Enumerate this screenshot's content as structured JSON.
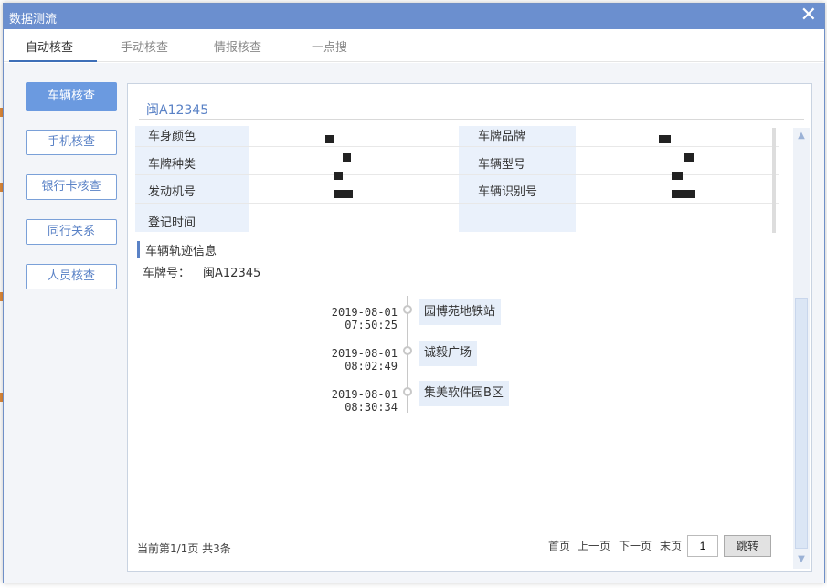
{
  "window": {
    "title": "数据测流",
    "close_glyph": "✕"
  },
  "tabs": [
    {
      "label": "自动核查",
      "active": true
    },
    {
      "label": "手动核查",
      "active": false
    },
    {
      "label": "情报核查",
      "active": false
    },
    {
      "label": "一点搜",
      "active": false
    }
  ],
  "sidebar": {
    "items": [
      {
        "label": "车辆核查",
        "active": true
      },
      {
        "label": "手机核查",
        "active": false
      },
      {
        "label": "银行卡核查",
        "active": false
      },
      {
        "label": "同行关系",
        "active": false
      },
      {
        "label": "人员核查",
        "active": false
      }
    ]
  },
  "vehicle": {
    "plate": "闽A12345",
    "fields": {
      "color_label": "车身颜色",
      "plate_type_label": "车牌种类",
      "engine_label": "发动机号",
      "reg_time_label": "登记时间",
      "brand_label": "车牌品牌",
      "model_label": "车辆型号",
      "vin_label": "车辆识别号"
    }
  },
  "trajectory": {
    "section_title": "车辆轨迹信息",
    "plate_label": "车牌号：",
    "plate_value": "闽A12345",
    "records": [
      {
        "time": "2019-08-01 07:50:25",
        "place": "园博苑地铁站"
      },
      {
        "time": "2019-08-01 08:02:49",
        "place": "诚毅广场"
      },
      {
        "time": "2019-08-01 08:30:34",
        "place": "集美软件园B区"
      }
    ]
  },
  "pagination": {
    "info": "当前第1/1页 共3条",
    "first": "首页",
    "prev": "上一页",
    "next": "下一页",
    "last": "末页",
    "page_value": "1",
    "jump": "跳转"
  },
  "colors": {
    "accent": "#6b8fcf",
    "active_btn": "#6b9ae0",
    "label_bg": "#eaf1fb"
  }
}
